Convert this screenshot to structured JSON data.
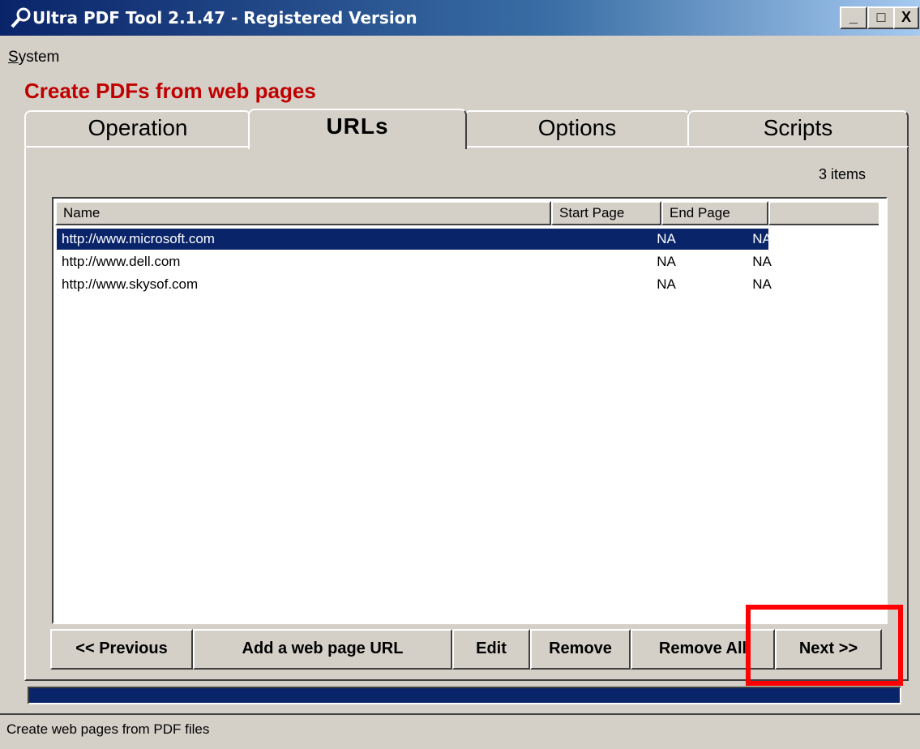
{
  "window": {
    "title": "Ultra PDF Tool 2.1.47 - Registered Version",
    "min_label": "_",
    "max_label": "□",
    "close_label": "X"
  },
  "menu": {
    "system_first": "S",
    "system_rest": "ystem"
  },
  "heading": "Create PDFs from web pages",
  "tabs": [
    {
      "label": "Operation",
      "active": false
    },
    {
      "label": "URLs",
      "active": true
    },
    {
      "label": "Options",
      "active": false
    },
    {
      "label": "Scripts",
      "active": false
    }
  ],
  "items_count": "3 items",
  "list": {
    "columns": [
      "Name",
      "Start Page",
      "End Page"
    ],
    "rows": [
      {
        "name": "http://www.microsoft.com",
        "start": "NA",
        "end": "NA",
        "selected": true
      },
      {
        "name": "http://www.dell.com",
        "start": "NA",
        "end": "NA",
        "selected": false
      },
      {
        "name": "http://www.skysof.com",
        "start": "NA",
        "end": "NA",
        "selected": false
      }
    ]
  },
  "buttons": {
    "previous": "<< Previous",
    "add_url": "Add a web page URL",
    "edit": "Edit",
    "remove": "Remove",
    "remove_all": "Remove All",
    "next": "Next >>"
  },
  "status": "Create web pages from PDF files",
  "colors": {
    "accent_heading": "#c00000",
    "selection": "#0a246a",
    "highlight": "#ff0000"
  }
}
